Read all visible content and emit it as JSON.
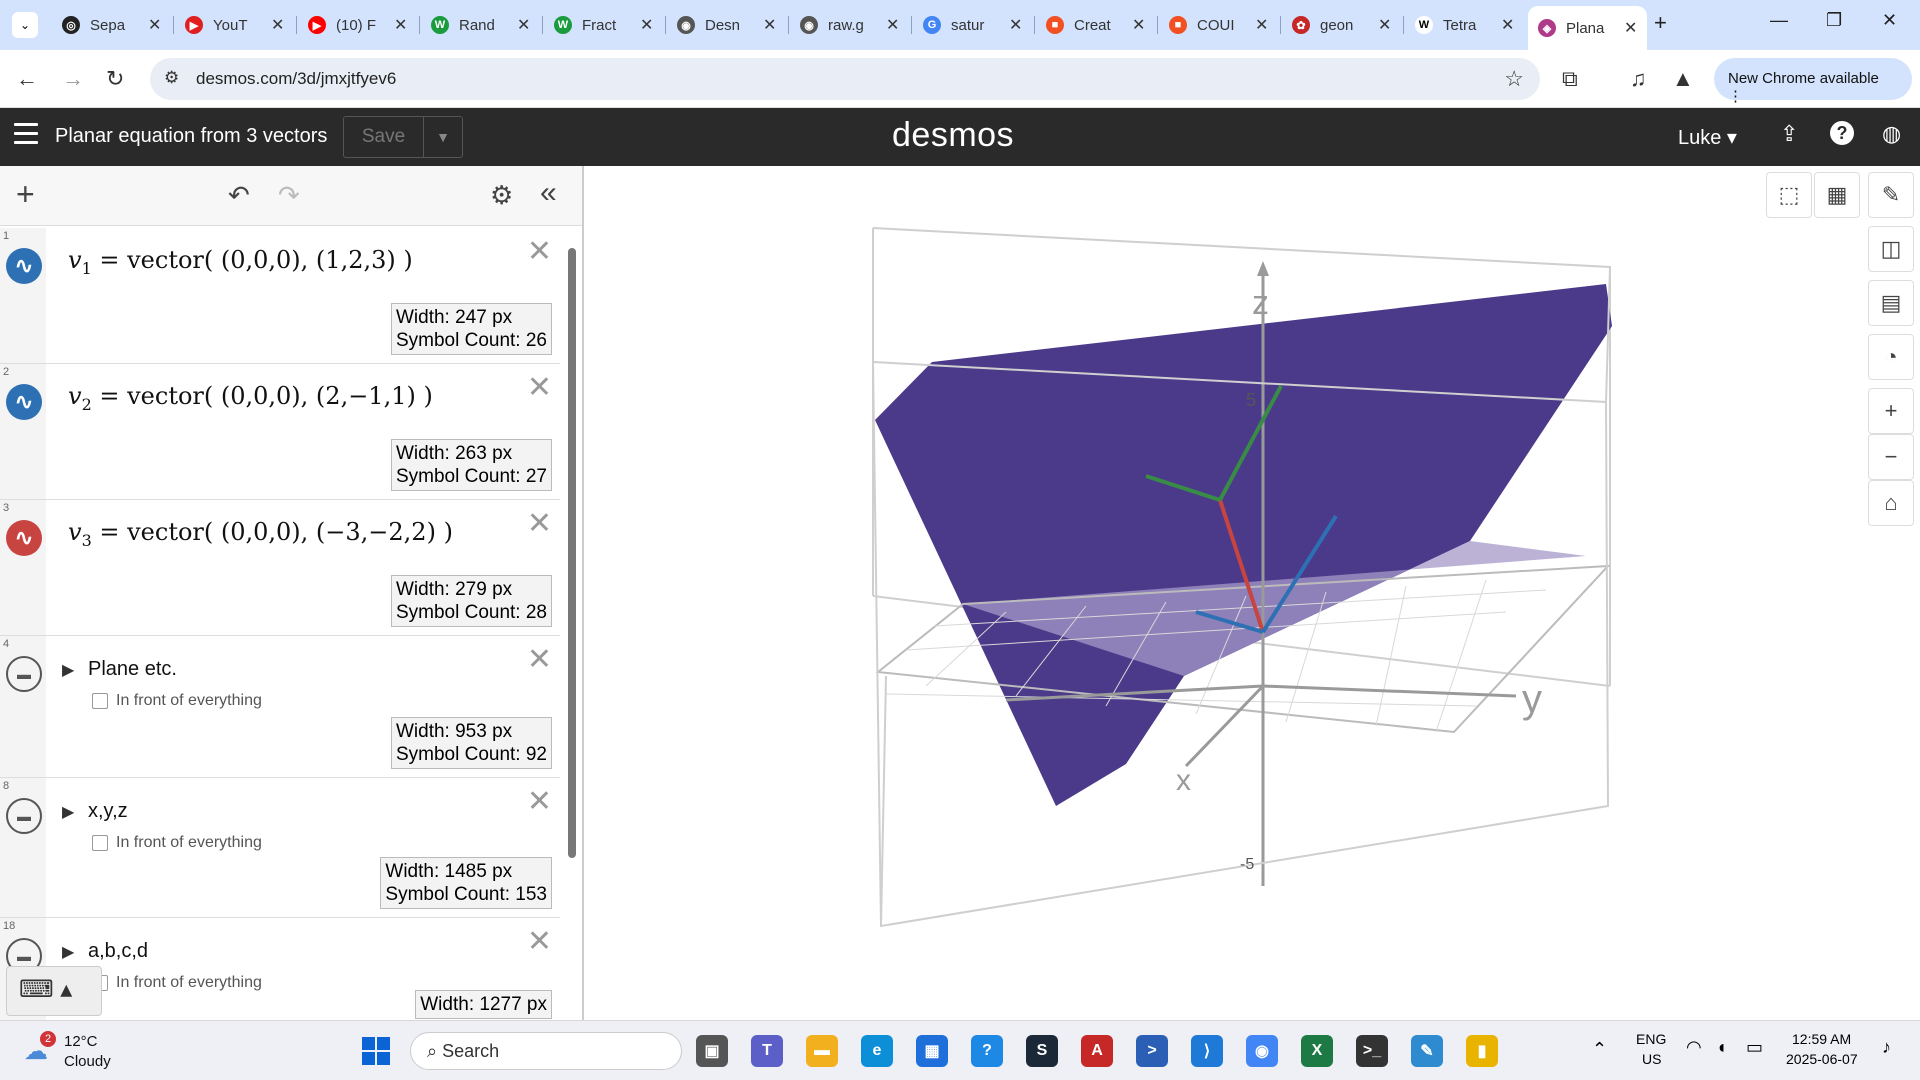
{
  "browser": {
    "tabs": [
      {
        "title": "Sepa",
        "color": "#222222",
        "glyph": "◎"
      },
      {
        "title": "YouT",
        "color": "#e02020",
        "glyph": "▶"
      },
      {
        "title": "(10) F",
        "color": "#ff0000",
        "glyph": "▶"
      },
      {
        "title": "Rand",
        "color": "#1a9c3e",
        "glyph": "W"
      },
      {
        "title": "Fract",
        "color": "#1a9c3e",
        "glyph": "W"
      },
      {
        "title": "Desn",
        "color": "#555555",
        "glyph": "◉"
      },
      {
        "title": "raw.g",
        "color": "#555555",
        "glyph": "◉"
      },
      {
        "title": "satur",
        "color": "#4285f4",
        "glyph": "G"
      },
      {
        "title": "Creat",
        "color": "#f25022",
        "glyph": "■"
      },
      {
        "title": "COUI",
        "color": "#f25022",
        "glyph": "■"
      },
      {
        "title": "geon",
        "color": "#c62828",
        "glyph": "✿"
      },
      {
        "title": "Tetra",
        "color": "#ffffff",
        "glyph": "W"
      },
      {
        "title": "Plana",
        "color": "#b03a8a",
        "glyph": "◈"
      }
    ],
    "url": "desmos.com/3d/jmxjtfyev6",
    "new_chrome": "New Chrome available"
  },
  "desmos": {
    "title": "Planar equation from 3 vectors",
    "save": "Save",
    "logo": "desmos",
    "user": "Luke"
  },
  "expressions": [
    {
      "num": "1",
      "type": "expr",
      "color": "#2d70b3",
      "name": "v",
      "sub": "1",
      "rest": " = vector( (0,0,0), (1,2,3) )",
      "width": "Width: 247 px",
      "symbols": "Symbol Count: 26"
    },
    {
      "num": "2",
      "type": "expr",
      "color": "#2d70b3",
      "name": "v",
      "sub": "2",
      "rest": " = vector( (0,0,0), (2,−1,1) )",
      "width": "Width: 263 px",
      "symbols": "Symbol Count: 27"
    },
    {
      "num": "3",
      "type": "expr",
      "color": "#c74440",
      "name": "v",
      "sub": "3",
      "rest": " = vector( (0,0,0), (−3,−2,2) )",
      "width": "Width: 279 px",
      "symbols": "Symbol Count: 28"
    },
    {
      "num": "4",
      "type": "folder",
      "title": "Plane etc.",
      "front": "In front of everything",
      "width": "Width: 953 px",
      "symbols": "Symbol Count: 92"
    },
    {
      "num": "8",
      "type": "folder",
      "title": "x,y,z",
      "front": "In front of everything",
      "width": "Width: 1485 px",
      "symbols": "Symbol Count: 153"
    },
    {
      "num": "18",
      "type": "folder",
      "title": "a,b,c,d",
      "front": "In front of everything",
      "width": "Width: 1277 px",
      "symbols": ""
    }
  ],
  "graph": {
    "axis_z": "z",
    "axis_y": "y",
    "axis_x": "x",
    "tick_5": "5",
    "tick_neg5": "-5",
    "plane_color": "#4b3a8a",
    "vector_colors": {
      "v1": "#2d70b3",
      "v2": "#2d70b3",
      "v3": "#c74440",
      "green": "#388c46"
    }
  },
  "taskbar": {
    "temp": "12°C",
    "weather": "Cloudy",
    "weather_badge": "2",
    "search": "Search",
    "lang": "ENG",
    "region": "US",
    "time": "12:59 AM",
    "date": "2025-06-07"
  }
}
